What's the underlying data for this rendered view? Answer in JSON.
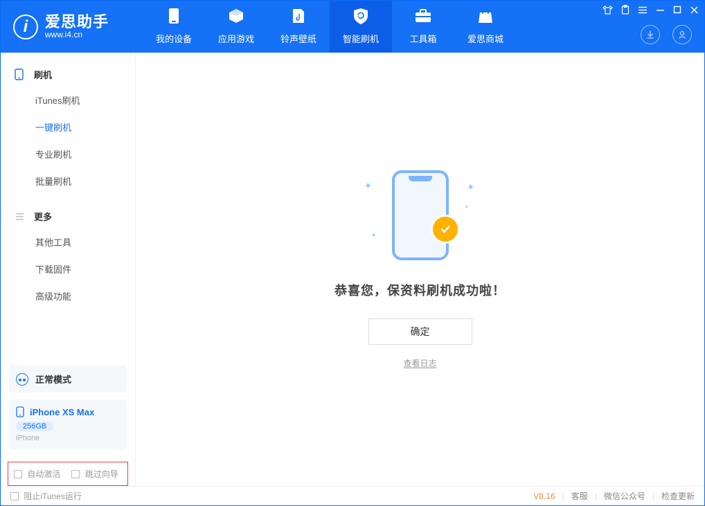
{
  "app": {
    "name": "爱思助手",
    "url": "www.i4.cn"
  },
  "tabs": {
    "device": "我的设备",
    "apps": "应用游戏",
    "ringtones": "铃声壁纸",
    "flash": "智能刷机",
    "tools": "工具箱",
    "store": "爱思商城"
  },
  "sidebar": {
    "flash_group": "刷机",
    "flash_items": {
      "itunes": "iTunes刷机",
      "oneclick": "一键刷机",
      "pro": "专业刷机",
      "batch": "批量刷机"
    },
    "more_group": "更多",
    "more_items": {
      "other": "其他工具",
      "firmware": "下载固件",
      "advanced": "高级功能"
    }
  },
  "device": {
    "mode": "正常模式",
    "name": "iPhone XS Max",
    "storage": "256GB",
    "type": "iPhone"
  },
  "options": {
    "autoActivate": "自动激活",
    "skipGuide": "跳过向导"
  },
  "main": {
    "successText": "恭喜您，保资料刷机成功啦！",
    "okButton": "确定",
    "viewLog": "查看日志"
  },
  "footer": {
    "blockItunes": "阻止iTunes运行",
    "version": "V8.16",
    "support": "客服",
    "wechat": "微信公众号",
    "checkUpdate": "检查更新"
  }
}
